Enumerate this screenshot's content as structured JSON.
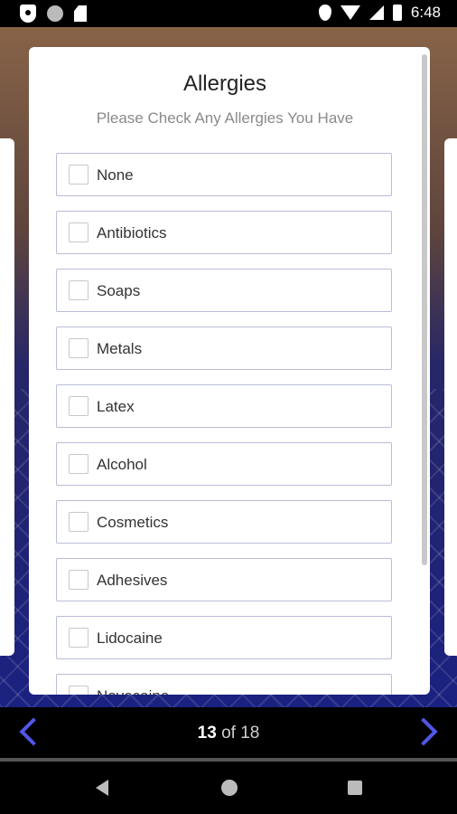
{
  "status_bar": {
    "time": "6:48",
    "icons": [
      "shield-icon",
      "circle-icon",
      "sdcard-icon",
      "location-icon",
      "wifi-icon",
      "signal-icon",
      "battery-icon"
    ]
  },
  "card": {
    "title": "Allergies",
    "subtitle": "Please Check Any Allergies You Have",
    "options": [
      {
        "label": "None",
        "checked": false
      },
      {
        "label": "Antibiotics",
        "checked": false
      },
      {
        "label": "Soaps",
        "checked": false
      },
      {
        "label": "Metals",
        "checked": false
      },
      {
        "label": "Latex",
        "checked": false
      },
      {
        "label": "Alcohol",
        "checked": false
      },
      {
        "label": "Cosmetics",
        "checked": false
      },
      {
        "label": "Adhesives",
        "checked": false
      },
      {
        "label": "Lidocaine",
        "checked": false
      },
      {
        "label": "Novocaine",
        "checked": false
      }
    ]
  },
  "pager": {
    "current": "13",
    "separator": " of ",
    "total": "18"
  },
  "colors": {
    "accent": "#5057e8",
    "option_border": "#b9bdd6"
  }
}
